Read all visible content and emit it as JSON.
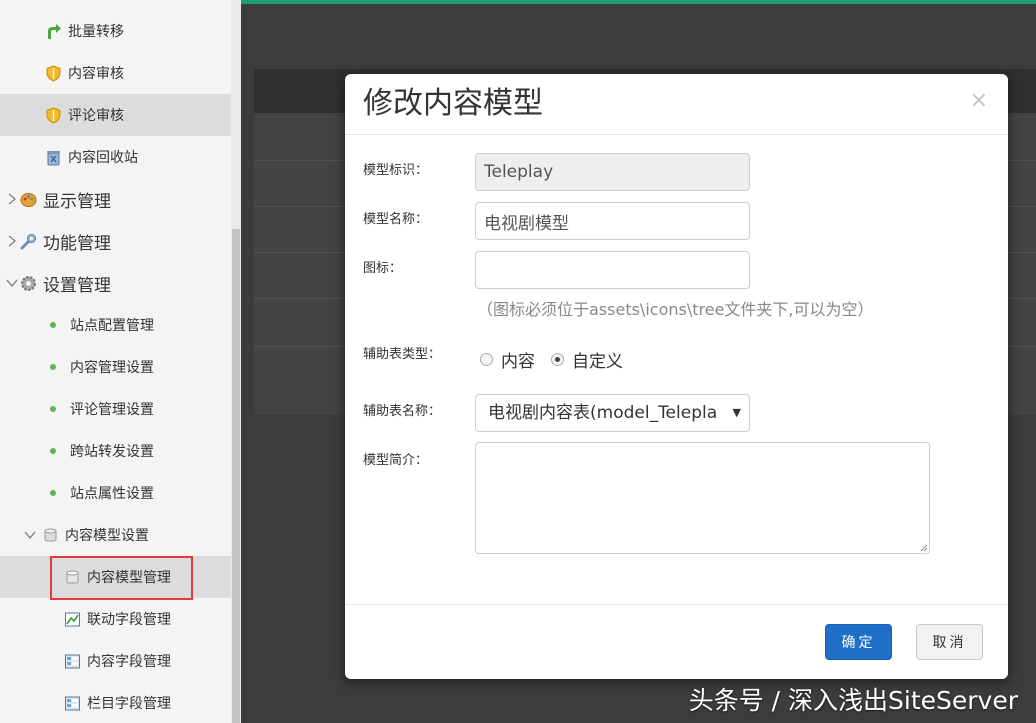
{
  "sidebar": {
    "items": [
      {
        "label": "批量转移",
        "icon": "green-arrow-icon"
      },
      {
        "label": "内容审核",
        "icon": "shield-icon"
      },
      {
        "label": "评论审核",
        "icon": "shield-icon"
      },
      {
        "label": "内容回收站",
        "icon": "recycle-bin-icon"
      },
      {
        "label": "显示管理",
        "icon": "palette-icon"
      },
      {
        "label": "功能管理",
        "icon": "wrench-icon"
      },
      {
        "label": "设置管理",
        "icon": "gear-icon"
      },
      {
        "label": "站点配置管理",
        "icon": "dot-icon"
      },
      {
        "label": "内容管理设置",
        "icon": "dot-icon"
      },
      {
        "label": "评论管理设置",
        "icon": "dot-icon"
      },
      {
        "label": "跨站转发设置",
        "icon": "dot-icon"
      },
      {
        "label": "站点属性设置",
        "icon": "dot-icon"
      },
      {
        "label": "内容模型设置",
        "icon": "database-icon"
      },
      {
        "label": "内容模型管理",
        "icon": "database-icon"
      },
      {
        "label": "联动字段管理",
        "icon": "chart-icon"
      },
      {
        "label": "内容字段管理",
        "icon": "form-icon"
      },
      {
        "label": "栏目字段管理",
        "icon": "form-icon"
      }
    ],
    "selected": "内容模型管理"
  },
  "modal": {
    "title": "修改内容模型",
    "close": "×",
    "fields": {
      "model_id_label": "模型标识：",
      "model_id_value": "Teleplay",
      "model_name_label": "模型名称：",
      "model_name_value": "电视剧模型",
      "icon_label": "图标：",
      "icon_value": "",
      "icon_hint": "（图标必须位于assets\\icons\\tree文件夹下,可以为空）",
      "aux_type_label": "辅助表类型：",
      "aux_type_options": [
        "内容",
        "自定义"
      ],
      "aux_type_selected": "自定义",
      "aux_name_label": "辅助表名称：",
      "aux_name_value": "电视剧内容表(model_Telepla",
      "desc_label": "模型简介：",
      "desc_value": ""
    },
    "buttons": {
      "ok": "确定",
      "cancel": "取消"
    }
  },
  "watermark": "头条号 / 深入浅出SiteServer",
  "colors": {
    "accent": "#1d9e71",
    "primary_button": "#1f6fc9",
    "highlight": "#e33b3b"
  }
}
